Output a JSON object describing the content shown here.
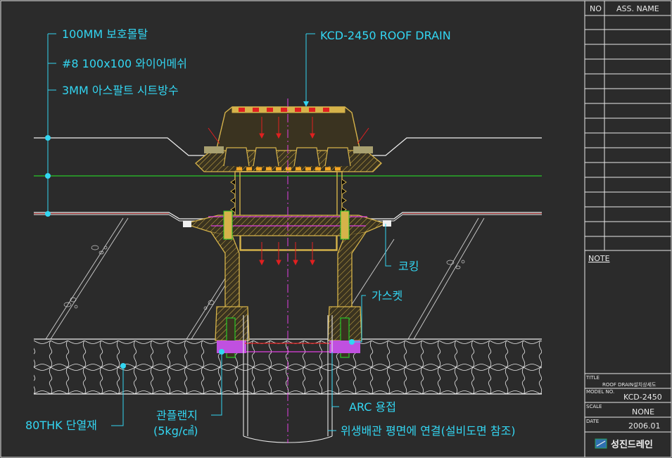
{
  "callouts": {
    "protect_mortar": "100MM 보호몰탈",
    "wire_mesh": "#8 100x100 와이어메쉬",
    "asphalt_sheet": "3MM 아스팔트 시트방수",
    "roof_drain": "KCD-2450 ROOF DRAIN",
    "caulking": "코킹",
    "gasket": "가스켓",
    "insulation": "80THK 단열재",
    "pipe_flange": "관플랜지",
    "flange_pressure": "(5kg/㎠)",
    "arc_weld": "ARC 용접",
    "sanitary_pipe": "위생배관 평면에 연결(설비도면 참조)"
  },
  "title_block": {
    "col_no": "NO",
    "col_name": "ASS. NAME",
    "note_label": "NOTE",
    "title_label": "TITLE",
    "title_value": "ROOF DRAIN설치상세도",
    "model_label": "MODEL NO.",
    "model_value": "KCD-2450",
    "scale_label": "SCALE",
    "scale_value": "NONE",
    "date_label": "DATE",
    "date_value": "2006.01",
    "company": "성진드레인"
  },
  "colors": {
    "background": "#2b2b2b",
    "callout": "#33d6f2",
    "body": "#d6b34a",
    "green_line": "#28c828",
    "magenta": "#e040e0",
    "red": "#e02020",
    "orange": "#f5a623",
    "white": "#f0f0f0"
  }
}
